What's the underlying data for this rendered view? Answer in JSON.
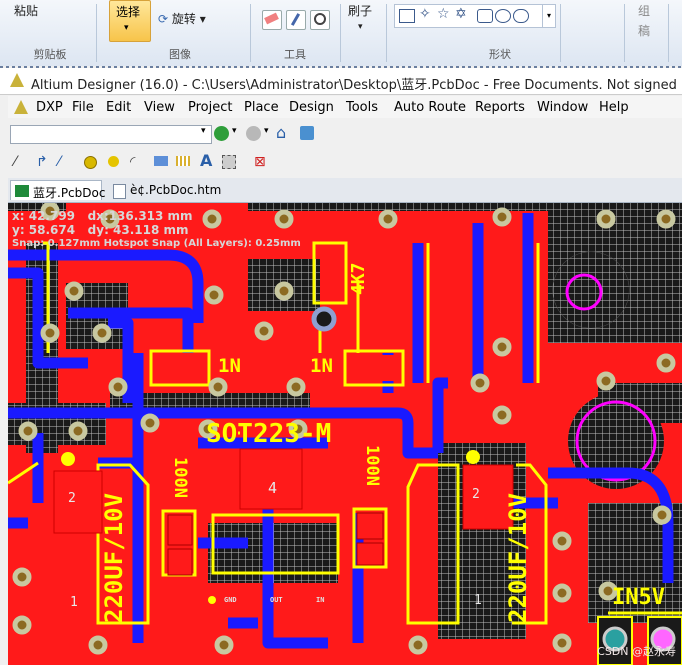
{
  "ribbon": {
    "paste_label": "粘贴",
    "clipboard_group": "剪贴板",
    "select_label": "选择",
    "rotate_label": "旋转",
    "image_group": "图像",
    "tools_group": "工具",
    "brush_label": "刷子",
    "shapes_group": "形状",
    "color_label": "组",
    "color_label2": "稿"
  },
  "window": {
    "title": "Altium Designer (16.0) - C:\\Users\\Administrator\\Desktop\\蓝牙.PcbDoc - Free Documents. Not signed in."
  },
  "menu": [
    "DXP",
    "File",
    "Edit",
    "View",
    "Project",
    "Place",
    "Design",
    "Tools",
    "Auto Route",
    "Reports",
    "Window",
    "Help"
  ],
  "tabs": [
    {
      "label": "蓝牙.PcbDoc",
      "active": true
    },
    {
      "label": "è¢.PcbDoc.htm",
      "active": false
    }
  ],
  "hud": {
    "x": "x: 42.799",
    "dx": "dx:136.313  mm",
    "y": "y: 58.674",
    "dy": "dy: 43.118   mm",
    "snap": "Snap: 0.127mm Hotspot Snap (All Layers): 0.25mm"
  },
  "pcb_labels": {
    "r_4k7": "4K7",
    "d1": "1N",
    "d2": "1N",
    "sot": "SOT223-M",
    "cap_left": "220UF/10V",
    "cap_right": "220UF/10V",
    "c100n_left": "100N",
    "c100n_right": "100N",
    "in5v": "IN5V",
    "pad4": "4",
    "pad2_left": "2",
    "pad2_right": "2",
    "pad1_left": "1",
    "pad1_right": "1",
    "pin_gnd": "GND",
    "pin_out": "OUT",
    "pin_in": "IN"
  },
  "watermark": "CSDN @赵永寿",
  "colors": {
    "top_layer": "#ff1a1a",
    "bottom_layer": "#1a1aff",
    "silkscreen": "#ffff00",
    "via_ring": "#c8c8a0",
    "keepout": "#ff00ff"
  }
}
